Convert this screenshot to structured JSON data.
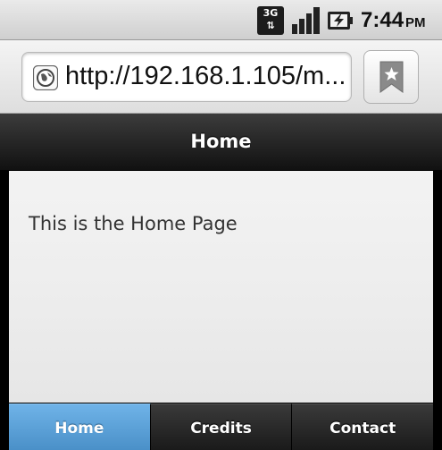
{
  "status_bar": {
    "network_type": "3G",
    "network_arrows": "⇅",
    "time": "7:44",
    "ampm": "PM",
    "icons": [
      "network-3g-icon",
      "signal-icon",
      "battery-charging-icon"
    ]
  },
  "browser": {
    "url": "http://192.168.1.105/m...",
    "icons": [
      "globe-icon",
      "bookmark-icon"
    ]
  },
  "header": {
    "title": "Home"
  },
  "content": {
    "text": "This is the Home Page"
  },
  "tabs": [
    {
      "label": "Home",
      "active": true
    },
    {
      "label": "Credits",
      "active": false
    },
    {
      "label": "Contact",
      "active": false
    }
  ],
  "colors": {
    "header_bg": "#1f1f1f",
    "active_tab": "#5fa4dc",
    "content_bg": "#ededed"
  }
}
